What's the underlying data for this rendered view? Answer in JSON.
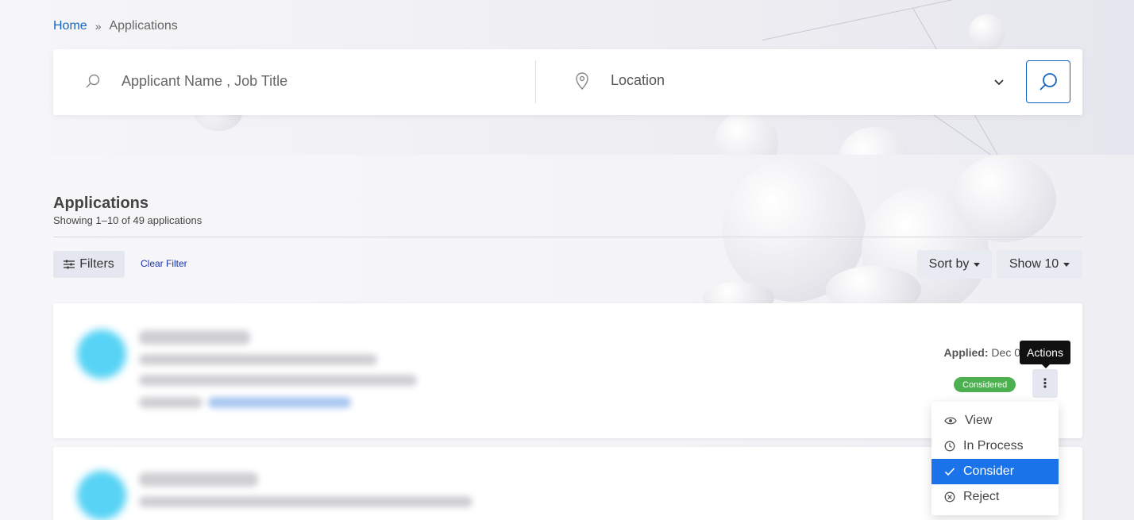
{
  "breadcrumb": {
    "home": "Home",
    "separator": "»",
    "current": "Applications"
  },
  "search": {
    "keyword_placeholder": "Applicant Name , Job Title",
    "keyword_value": "",
    "location_placeholder": "Location"
  },
  "listing": {
    "title": "Applications",
    "summary": "Showing 1–10 of 49 applications",
    "filters_label": "Filters",
    "clear_filter_label": "Clear Filter",
    "sort_label": "Sort by",
    "show_label": "Show 10"
  },
  "applications": [
    {
      "applied_label": "Applied:",
      "applied_date": "Dec 0",
      "status": "Considered",
      "actions_tooltip": "Actions",
      "actions_glyph": "⋮"
    }
  ],
  "actions_menu": {
    "items": [
      {
        "label": "View",
        "icon": "eye-icon"
      },
      {
        "label": "In Process",
        "icon": "clock-icon"
      },
      {
        "label": "Consider",
        "icon": "check-icon",
        "active": true
      },
      {
        "label": "Reject",
        "icon": "x-circle-icon"
      }
    ]
  },
  "colors": {
    "link": "#1565c0",
    "status_considered": "#4caf50",
    "menu_active": "#1a73e8",
    "avatar": "#57d3f5"
  }
}
